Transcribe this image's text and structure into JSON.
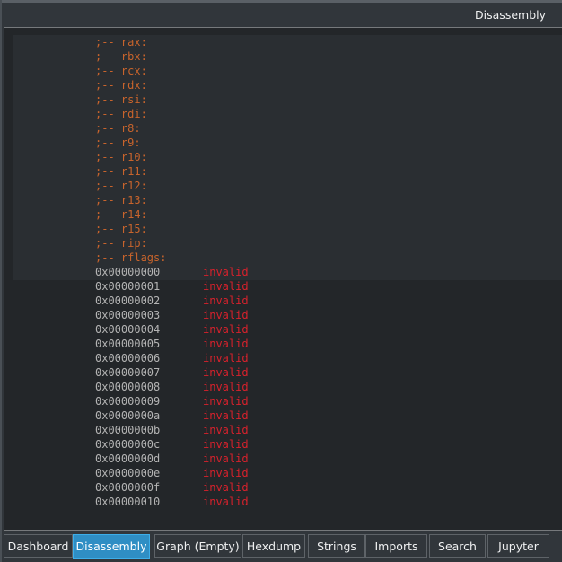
{
  "window": {
    "title": "Disassembly"
  },
  "flags": [
    ";-- rax:",
    ";-- rbx:",
    ";-- rcx:",
    ";-- rdx:",
    ";-- rsi:",
    ";-- rdi:",
    ";-- r8:",
    ";-- r9:",
    ";-- r10:",
    ";-- r11:",
    ";-- r12:",
    ";-- r13:",
    ";-- r14:",
    ";-- r15:",
    ";-- rip:",
    ";-- rflags:"
  ],
  "instructions": [
    {
      "address": "0x00000000",
      "opcode": "invalid"
    },
    {
      "address": "0x00000001",
      "opcode": "invalid"
    },
    {
      "address": "0x00000002",
      "opcode": "invalid"
    },
    {
      "address": "0x00000003",
      "opcode": "invalid"
    },
    {
      "address": "0x00000004",
      "opcode": "invalid"
    },
    {
      "address": "0x00000005",
      "opcode": "invalid"
    },
    {
      "address": "0x00000006",
      "opcode": "invalid"
    },
    {
      "address": "0x00000007",
      "opcode": "invalid"
    },
    {
      "address": "0x00000008",
      "opcode": "invalid"
    },
    {
      "address": "0x00000009",
      "opcode": "invalid"
    },
    {
      "address": "0x0000000a",
      "opcode": "invalid"
    },
    {
      "address": "0x0000000b",
      "opcode": "invalid"
    },
    {
      "address": "0x0000000c",
      "opcode": "invalid"
    },
    {
      "address": "0x0000000d",
      "opcode": "invalid"
    },
    {
      "address": "0x0000000e",
      "opcode": "invalid"
    },
    {
      "address": "0x0000000f",
      "opcode": "invalid"
    },
    {
      "address": "0x00000010",
      "opcode": "invalid"
    }
  ],
  "tabs": [
    {
      "label": "Dashboard",
      "active": false
    },
    {
      "label": "Disassembly",
      "active": true
    },
    {
      "label": "Graph (Empty)",
      "active": false
    },
    {
      "label": "Hexdump",
      "active": false
    },
    {
      "label": "Strings",
      "active": false
    },
    {
      "label": "Imports",
      "active": false
    },
    {
      "label": "Search",
      "active": false
    },
    {
      "label": "Jupyter",
      "active": false
    }
  ],
  "colors": {
    "flag": "#c8642c",
    "address": "#b4b4b4",
    "invalid": "#d8212c",
    "active_tab": "#2f8ec4"
  }
}
